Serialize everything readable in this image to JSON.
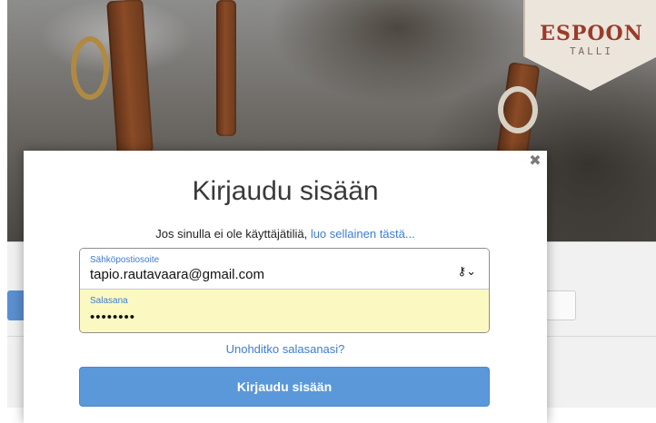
{
  "brand": {
    "title": "ESPOON",
    "subtitle": "TALLI"
  },
  "modal": {
    "title": "Kirjaudu sisään",
    "close_glyph": "✖",
    "signup_text": "Jos sinulla ei ole käyttäjätiliä,",
    "signup_link": "luo sellainen tästä...",
    "email": {
      "label": "Sähköpostiosoite",
      "value": "tapio.rautavaara@gmail.com"
    },
    "password": {
      "label": "Salasana",
      "value": "••••••••"
    },
    "keychain_icon": "key-icon",
    "keychain_glyph": "⚷⌄",
    "forgot_link": "Unohditko salasanasi?",
    "submit_label": "Kirjaudu sisään"
  },
  "colors": {
    "link": "#3c7dd0",
    "button": "#5b98da",
    "autofill": "#fbf9c1"
  }
}
